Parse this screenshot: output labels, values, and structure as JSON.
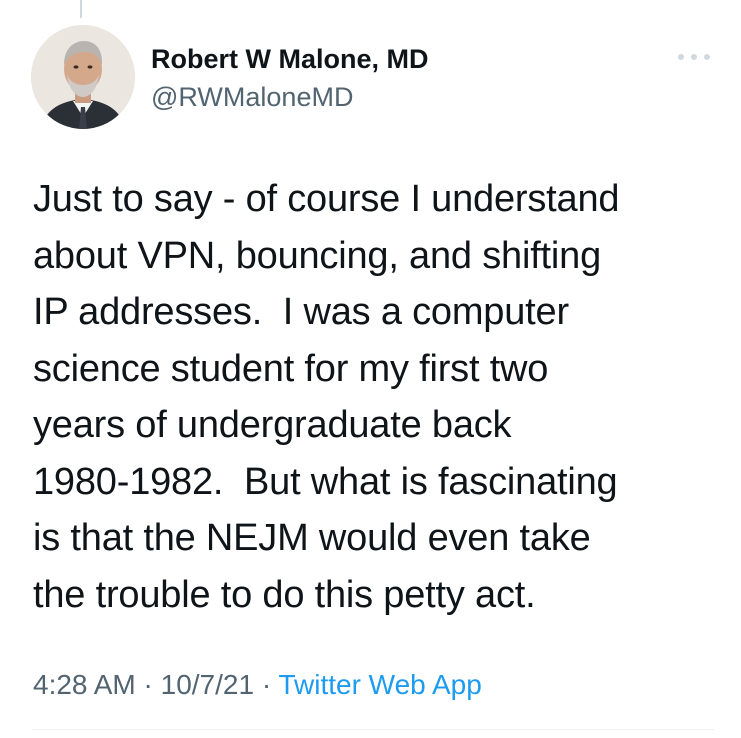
{
  "tweet": {
    "author": {
      "name": "Robert W Malone, MD",
      "handle": "@RWMaloneMD"
    },
    "more_icon": "more-horizontal-icon",
    "text_lines": [
      "Just to say - of course I understand",
      "about VPN, bouncing, and shifting",
      "IP addresses.  I was a computer",
      "science student for my first two",
      "years of undergraduate back",
      "1980-1982.  But what is fascinating",
      "is that the NEJM would even take",
      "the trouble to do this petty act."
    ],
    "meta": {
      "time": "4:28 AM",
      "separator": " · ",
      "date": "10/7/21",
      "source": "Twitter Web App"
    }
  },
  "colors": {
    "text": "#0f1419",
    "secondary": "#536471",
    "link": "#1d9bf0",
    "divider": "#eff3f4"
  }
}
